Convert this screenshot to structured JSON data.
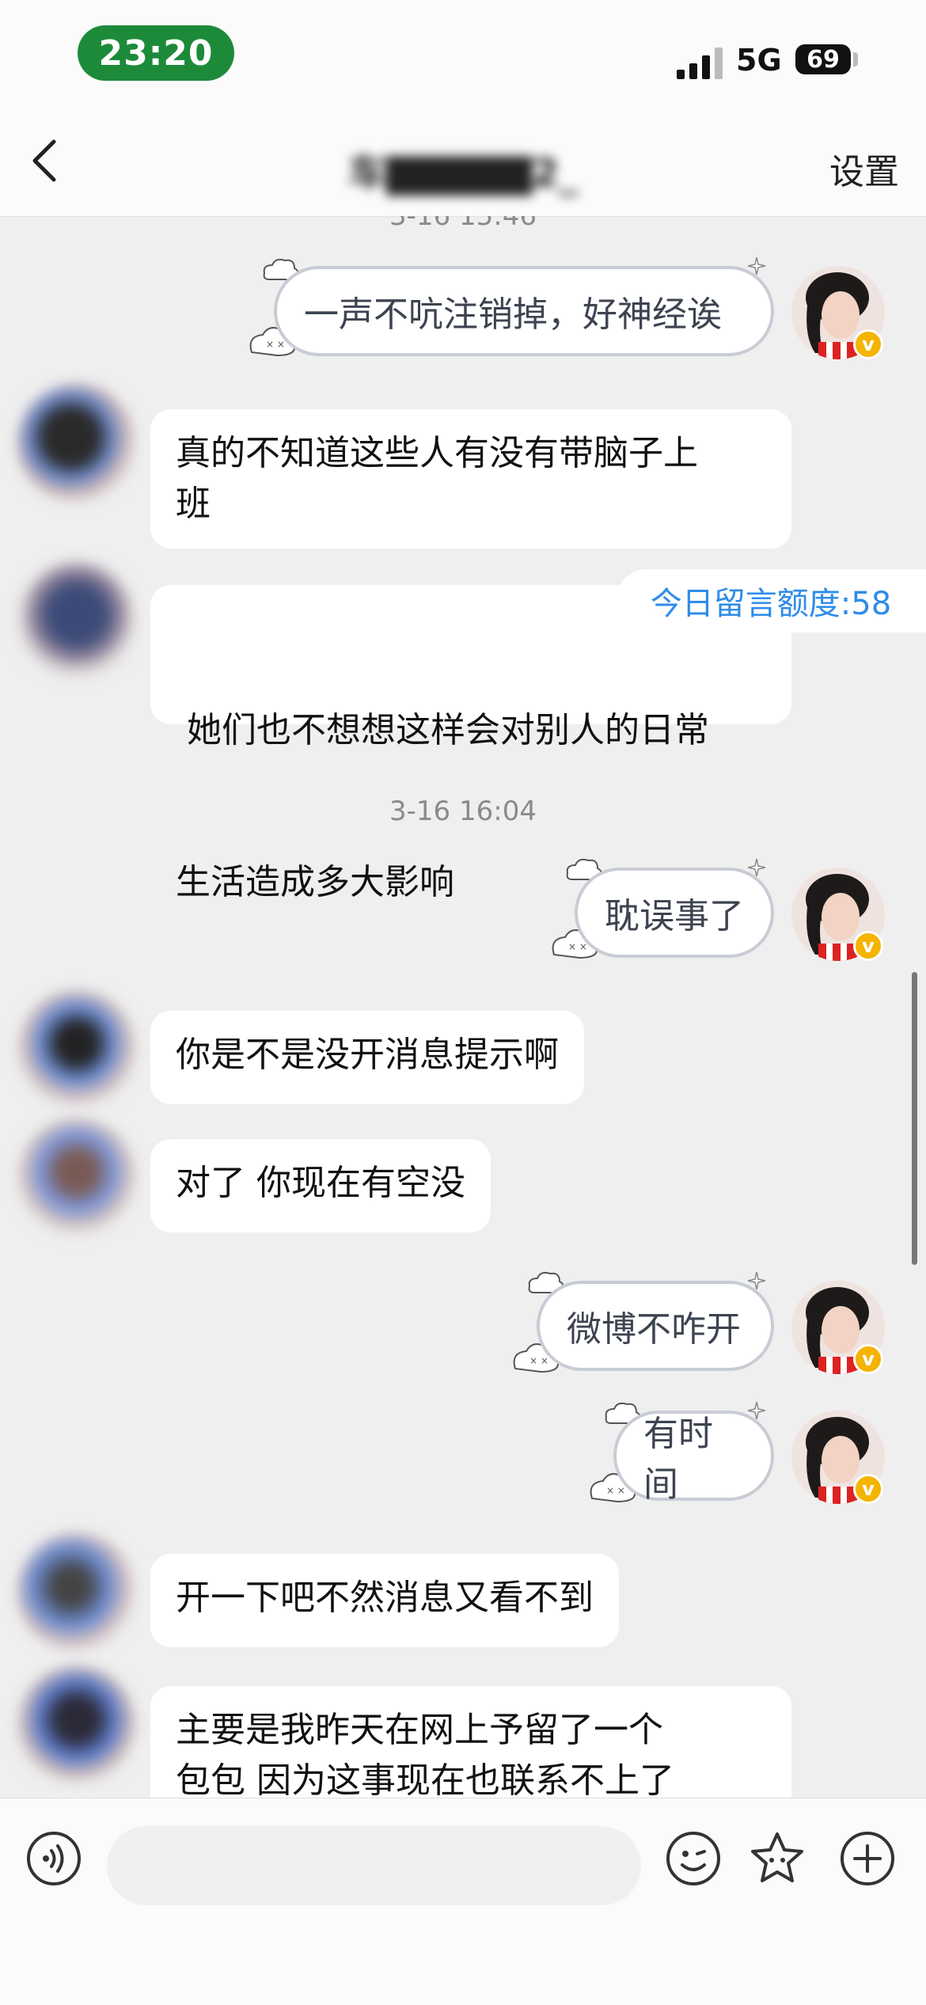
{
  "status_bar": {
    "time": "23:20",
    "network": "5G",
    "battery": "69"
  },
  "nav": {
    "title": "车▇▇▇▇▇2_",
    "settings_label": "设置"
  },
  "quota_text": "今日留言额度:58",
  "timestamps": [
    "3-16 15:46",
    "3-16 16:04"
  ],
  "messages": [
    {
      "side": "right",
      "text": "一声不吭注销掉，好神经诶"
    },
    {
      "side": "left",
      "lines": [
        "真的不知道这些人有没有带脑子上",
        "班"
      ]
    },
    {
      "side": "left",
      "lines": [
        " 她们也不想想这样会对别人的日常",
        "生活造成多大影响"
      ]
    },
    {
      "side": "right",
      "text": "耽误事了"
    },
    {
      "side": "left",
      "text": "你是不是没开消息提示啊"
    },
    {
      "side": "left",
      "text": "对了 你现在有空没"
    },
    {
      "side": "right",
      "text": "微博不咋开"
    },
    {
      "side": "right",
      "text": "有时间"
    },
    {
      "side": "left",
      "text": "开一下吧不然消息又看不到"
    },
    {
      "side": "left",
      "lines": [
        "主要是我昨天在网上予留了一个",
        "包包 因为这事现在也联系不上了"
      ]
    }
  ],
  "badge_letter": "v",
  "input": {
    "placeholder": ""
  },
  "colors": {
    "accent_blue": "#2e8ce8",
    "time_pill": "#1d8a3a",
    "vip_badge": "#f4b400"
  }
}
